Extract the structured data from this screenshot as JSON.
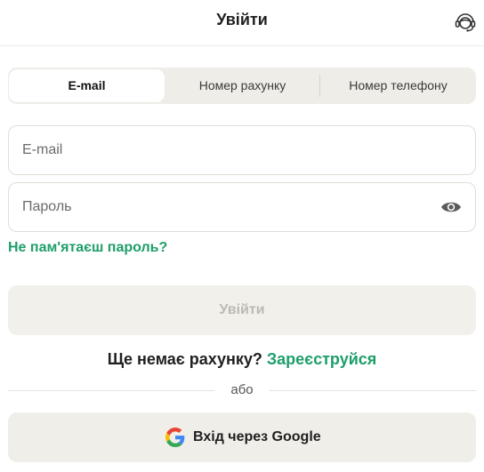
{
  "header": {
    "title": "Увійти",
    "support_icon": "support-headset-icon"
  },
  "tabs": [
    {
      "label": "E-mail",
      "active": true
    },
    {
      "label": "Номер рахунку",
      "active": false
    },
    {
      "label": "Номер телефону",
      "active": false
    }
  ],
  "form": {
    "email_placeholder": "E-mail",
    "email_value": "",
    "password_placeholder": "Пароль",
    "password_value": "",
    "show_password_icon": "eye-icon",
    "forgot_label": "Не пам'ятаєш пароль?",
    "submit_label": "Увійти",
    "submit_enabled": false
  },
  "signup": {
    "prompt": "Ще немає рахунку?",
    "link_label": "Зареєструйся"
  },
  "divider": {
    "label": "або"
  },
  "google": {
    "label": "Вхід через Google",
    "icon": "google-icon"
  },
  "colors": {
    "accent": "#1e9e6b",
    "tab_background": "#efede8",
    "button_disabled_bg": "#f2f0eb",
    "button_disabled_text": "#bcb9b3"
  }
}
